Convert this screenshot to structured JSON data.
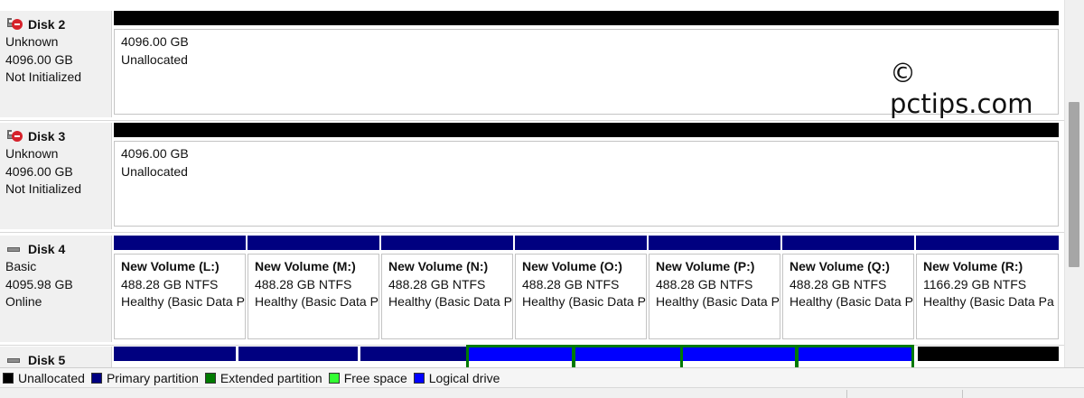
{
  "disks": [
    {
      "id": "disk2",
      "name": "Disk 2",
      "info": [
        "Unknown",
        "4096.00 GB",
        "Not Initialized"
      ],
      "icon": "disk-uninitialized-icon",
      "partitions": [
        {
          "lines": [
            "4096.00 GB",
            "Unallocated"
          ],
          "bar_color": "#000000"
        }
      ]
    },
    {
      "id": "disk3",
      "name": "Disk 3",
      "info": [
        "Unknown",
        "4096.00 GB",
        "Not Initialized"
      ],
      "icon": "disk-uninitialized-icon",
      "partitions": [
        {
          "lines": [
            "4096.00 GB",
            "Unallocated"
          ],
          "bar_color": "#000000"
        }
      ]
    },
    {
      "id": "disk4",
      "name": "Disk 4",
      "info": [
        "Basic",
        "4095.98 GB",
        "Online"
      ],
      "icon": "disk-drive-icon",
      "partitions": [
        {
          "name": "New Volume  (L:)",
          "lines": [
            "488.28 GB NTFS",
            "Healthy (Basic Data P"
          ],
          "bar_color": "#000080"
        },
        {
          "name": "New Volume  (M:)",
          "lines": [
            "488.28 GB NTFS",
            "Healthy (Basic Data P"
          ],
          "bar_color": "#000080"
        },
        {
          "name": "New Volume  (N:)",
          "lines": [
            "488.28 GB NTFS",
            "Healthy (Basic Data P"
          ],
          "bar_color": "#000080"
        },
        {
          "name": "New Volume  (O:)",
          "lines": [
            "488.28 GB NTFS",
            "Healthy (Basic Data P"
          ],
          "bar_color": "#000080"
        },
        {
          "name": "New Volume  (P:)",
          "lines": [
            "488.28 GB NTFS",
            "Healthy (Basic Data P"
          ],
          "bar_color": "#000080"
        },
        {
          "name": "New Volume  (Q:)",
          "lines": [
            "488.28 GB NTFS",
            "Healthy (Basic Data P"
          ],
          "bar_color": "#000080"
        },
        {
          "name": "New Volume  (R:)",
          "lines": [
            "1166.29 GB NTFS",
            "Healthy (Basic Data Pa"
          ],
          "bar_color": "#000080"
        }
      ]
    },
    {
      "id": "disk5",
      "name": "Disk 5",
      "info": [],
      "icon": "disk-drive-icon",
      "partitions": [
        {
          "bar_color": "#000080"
        },
        {
          "bar_color": "#000080"
        },
        {
          "bar_color": "#000080"
        },
        {
          "bar_color": "#0000ff",
          "extended": true
        },
        {
          "bar_color": "#0000ff",
          "extended": true
        },
        {
          "bar_color": "#0000ff",
          "extended": true
        },
        {
          "bar_color": "#0000ff",
          "extended": true
        },
        {
          "bar_color": "#000000"
        }
      ]
    }
  ],
  "legend": [
    {
      "label": "Unallocated",
      "color": "#000000"
    },
    {
      "label": "Primary partition",
      "color": "#000080"
    },
    {
      "label": "Extended partition",
      "color": "#007a00"
    },
    {
      "label": "Free space",
      "color": "#33ff33"
    },
    {
      "label": "Logical drive",
      "color": "#0000ff"
    }
  ],
  "watermark": "© pctips.com"
}
